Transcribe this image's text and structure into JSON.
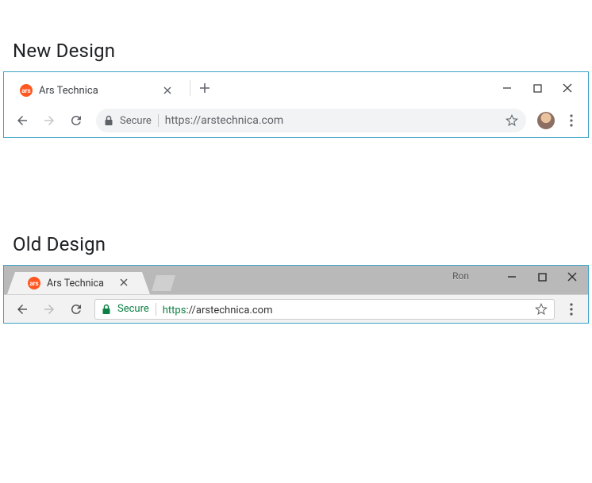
{
  "labels": {
    "new_design": "New Design",
    "old_design": "Old Design"
  },
  "new": {
    "tab": {
      "title": "Ars Technica",
      "favicon_text": "ars"
    },
    "omnibox": {
      "secure_label": "Secure",
      "url": "https://arstechnica.com"
    }
  },
  "old": {
    "tab": {
      "title": "Ars Technica",
      "favicon_text": "ars"
    },
    "user_label": "Ron",
    "omnibox": {
      "secure_label": "Secure",
      "url_scheme": "https",
      "url_rest": "://arstechnica.com"
    }
  }
}
